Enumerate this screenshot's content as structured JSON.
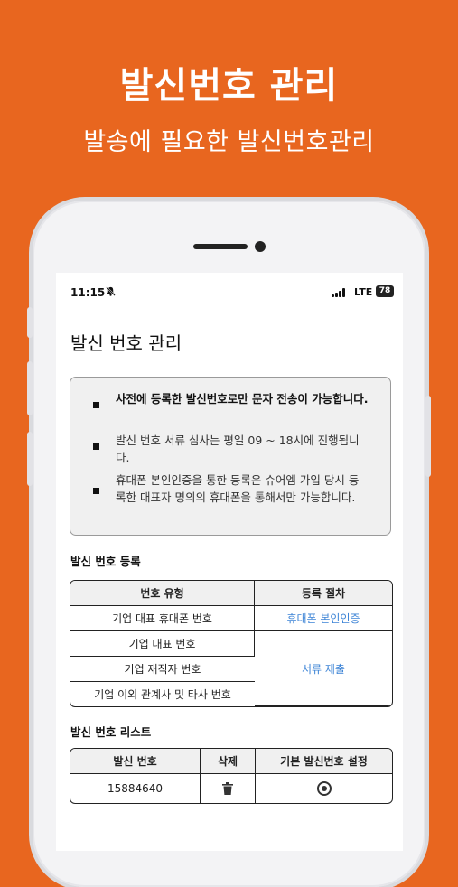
{
  "promo": {
    "headline": "발신번호 관리",
    "subline": "발송에 필요한 발신번호관리"
  },
  "status_bar": {
    "time": "11:15",
    "network": "LTE",
    "battery": "78"
  },
  "page": {
    "title": "발신 번호 관리"
  },
  "notices": [
    {
      "text": "사전에 등록한 발신번호로만 문자 전송이 가능합니다.",
      "bold": true
    },
    {
      "text": "발신 번호 서류 심사는 평일 09 ~ 18시에 진행됩니다.",
      "bold": false
    },
    {
      "text": "휴대폰 본인인증을 통한 등록은 슈어엠 가입 당시 등록한 대표자 명의의 휴대폰을 통해서만 가능합니다.",
      "bold": false
    }
  ],
  "registration": {
    "label": "발신 번호 등록",
    "headers": [
      "번호 유형",
      "등록 절차"
    ],
    "rows": [
      {
        "type": "기업 대표 휴대폰 번호",
        "procedure": "휴대폰 본인인증"
      },
      {
        "type": "기업 대표 번호"
      },
      {
        "type": "기업 재직자 번호"
      },
      {
        "type": "기업 이외 관계사 및 타사 번호"
      }
    ],
    "merged_procedure": "서류 제출"
  },
  "list": {
    "label": "발신 번호 리스트",
    "headers": [
      "발신 번호",
      "삭제",
      "기본 발신번호 설정"
    ],
    "rows": [
      {
        "number": "15884640"
      }
    ]
  },
  "colors": {
    "background": "#e8661f",
    "link": "#3d84d6"
  },
  "icons": {
    "bell": "bell-slash-icon",
    "signal": "signal-icon",
    "battery": "battery-icon",
    "delete": "trash-icon",
    "default": "radio-selected-icon"
  }
}
